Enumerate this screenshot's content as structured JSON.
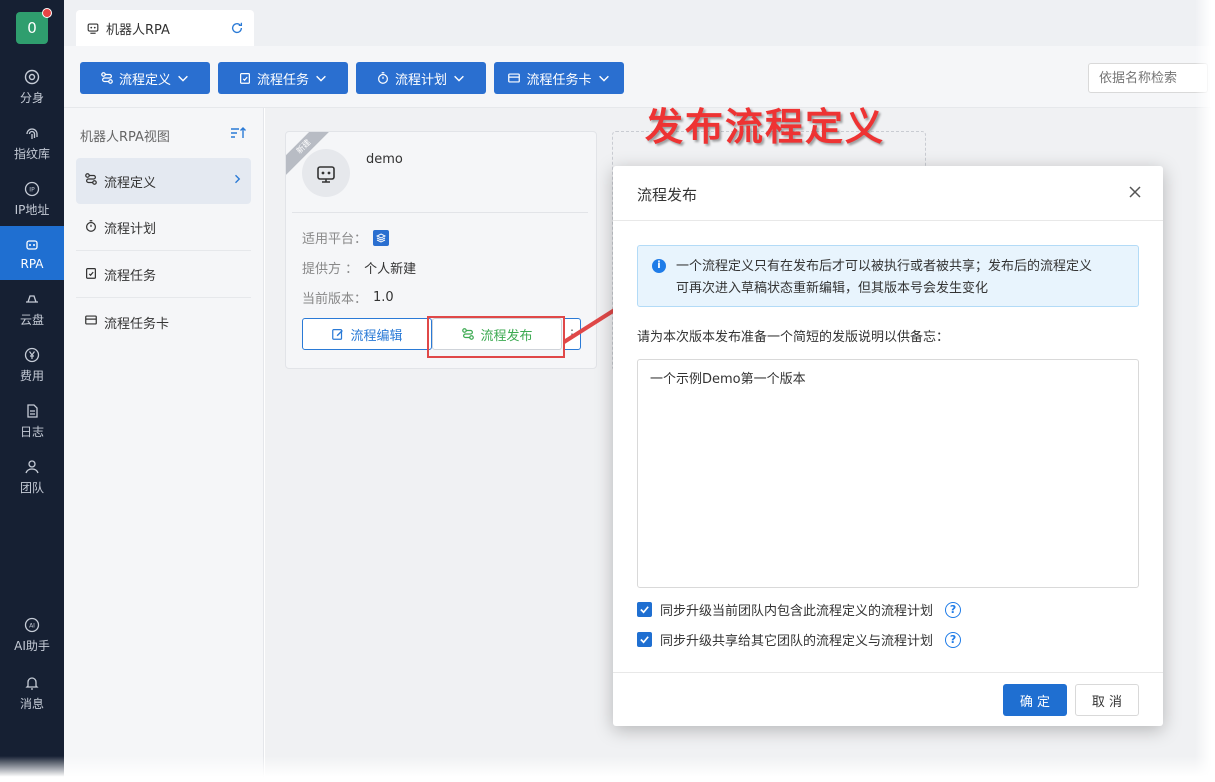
{
  "leftnav": {
    "avatar_text": "0",
    "items": [
      {
        "label": "分身",
        "icon": "chrome-icon"
      },
      {
        "label": "指纹库",
        "icon": "fingerprint-icon"
      },
      {
        "label": "IP地址",
        "icon": "ip-icon"
      },
      {
        "label": "RPA",
        "icon": "robot-icon"
      },
      {
        "label": "云盘",
        "icon": "cloud-drive-icon"
      },
      {
        "label": "费用",
        "icon": "yen-icon"
      },
      {
        "label": "日志",
        "icon": "log-icon"
      },
      {
        "label": "团队",
        "icon": "team-icon"
      },
      {
        "label": "AI助手",
        "icon": "ai-icon"
      },
      {
        "label": "消息",
        "icon": "bell-icon"
      }
    ]
  },
  "tab": {
    "label": "机器人RPA"
  },
  "toolbar": {
    "buttons": [
      "流程定义",
      "流程任务",
      "流程计划",
      "流程任务卡"
    ],
    "search_placeholder": "依据名称检索"
  },
  "sidepanel": {
    "title": "机器人RPA视图",
    "items": [
      "流程定义",
      "流程计划",
      "流程任务",
      "流程任务卡"
    ]
  },
  "card": {
    "ribbon": "新建",
    "name": "demo",
    "platform_label": "适用平台：",
    "provider_label": "提供方 ：",
    "provider_value": "个人新建",
    "version_label": "当前版本：",
    "version_value": "1.0",
    "edit_label": "流程编辑",
    "publish_label": "流程发布"
  },
  "annotation": {
    "text": "发布流程定义",
    "color": "#ee3333"
  },
  "modal": {
    "title": "流程发布",
    "info_line1": "一个流程定义只有在发布后才可以被执行或者被共享；发布后的流程定义",
    "info_line2": "可再次进入草稿状态重新编辑，但其版本号会发生变化",
    "prompt": "请为本次版本发布准备一个简短的发版说明以供备忘：",
    "notes_value": "一个示例Demo第一个版本",
    "check1": "同步升级当前团队内包含此流程定义的流程计划",
    "check2": "同步升级共享给其它团队的流程定义与流程计划",
    "ok_label": "确 定",
    "cancel_label": "取 消"
  },
  "colors": {
    "primary": "#1f6fd1",
    "nav_bg": "#162033",
    "publish_green": "#3daa52",
    "highlight_red": "#e04848"
  }
}
